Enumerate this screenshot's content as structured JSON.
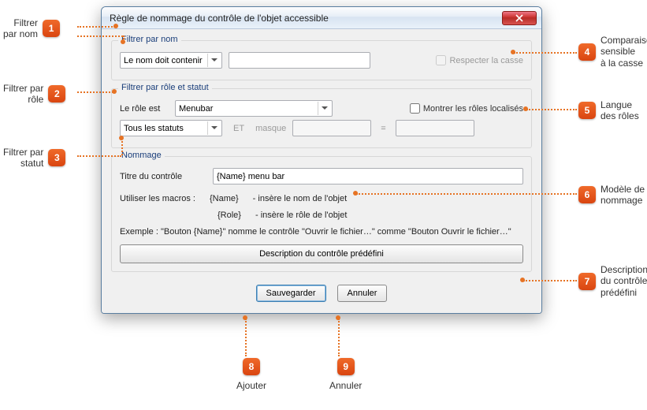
{
  "window_title": "Règle de nommage du contrôle de l'objet accessible",
  "groups": {
    "filter_name": {
      "legend": "Filtrer par nom",
      "name_rule_selected": "Le nom doit contenir",
      "name_value": "",
      "respect_case": "Respecter la casse"
    },
    "filter_role": {
      "legend": "Filtrer par rôle et statut",
      "role_label": "Le rôle est",
      "role_selected": "Menubar",
      "show_localized_roles": "Montrer les rôles localisés",
      "status_selected": "Tous les statuts",
      "et_label": "ET",
      "mask_label": "masque",
      "mask_value": "",
      "mask_compare": ""
    },
    "naming": {
      "legend": "Nommage",
      "title_label": "Titre du contrôle",
      "title_value": "{Name} menu bar",
      "macros_intro": "Utiliser les macros :",
      "macro_name": "{Name}",
      "macro_name_desc": "- insère le nom de l'objet",
      "macro_role": "{Role}",
      "macro_role_desc": "- insère le rôle de l'objet",
      "example": "Exemple : \"Bouton {Name}\" nomme le contrôle \"Ouvrir le fichier…\" comme \"Bouton Ouvrir le fichier…\"",
      "predef_button": "Description du contrôle prédéfini"
    }
  },
  "buttons": {
    "save": "Sauvegarder",
    "cancel": "Annuler"
  },
  "callouts": {
    "c1": "Filtrer\npar nom",
    "c2": "Filtrer par\nrôle",
    "c3": "Filtrer par\nstatut",
    "c4": "Comparaison\nsensible\nà la casse",
    "c5": "Langue\ndes rôles",
    "c6": "Modèle de\nnommage",
    "c7": "Description\ndu contrôle\nprédéfini",
    "c8": "Ajouter",
    "c9": "Annuler",
    "n1": "1",
    "n2": "2",
    "n3": "3",
    "n4": "4",
    "n5": "5",
    "n6": "6",
    "n7": "7",
    "n8": "8",
    "n9": "9"
  }
}
